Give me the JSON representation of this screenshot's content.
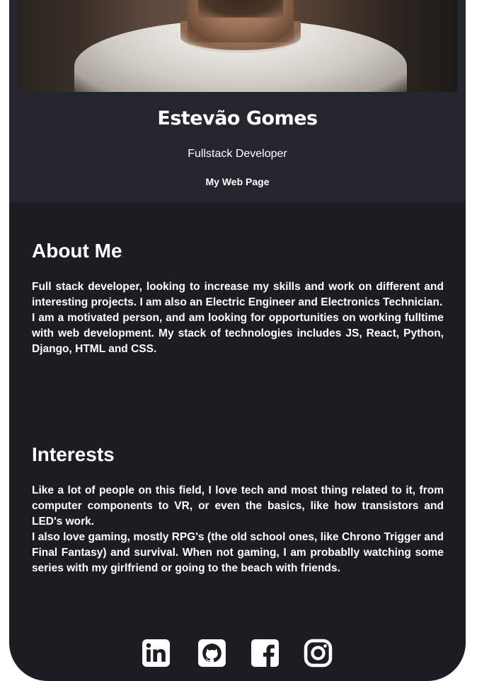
{
  "profile": {
    "name": "Estevão Gomes",
    "role": "Fullstack Developer",
    "web_link": "My Web Page"
  },
  "about": {
    "title": "About Me",
    "paragraphs": [
      "Full stack developer, looking to increase my skills and work on different and interesting projects. I am also an Electric Engineer and Electronics Technician.",
      "I am a motivated person, and am looking for opportunities on working fulltime with web development. My stack of technologies includes JS, React, Python, Django, HTML and CSS."
    ]
  },
  "interests": {
    "title": "Interests",
    "paragraphs": [
      "Like a lot of people on this field, I love tech and most thing related to it, from computer components to VR, or even the basics, like how transistors and LED's work.",
      "I also love gaming, mostly RPG's (the old school ones, like Chrono Trigger and Final Fantasy) and survival. When not gaming, I am probablly watching some series with my girlfriend or going to the beach with friends."
    ]
  },
  "socials": [
    {
      "icon": "linkedin-icon"
    },
    {
      "icon": "github-icon"
    },
    {
      "icon": "facebook-icon"
    },
    {
      "icon": "instagram-icon"
    }
  ],
  "colors": {
    "page_background": "#ffffff",
    "card_background": "#1c1d22",
    "header_background": "#24262d",
    "text": "#ffffff"
  }
}
